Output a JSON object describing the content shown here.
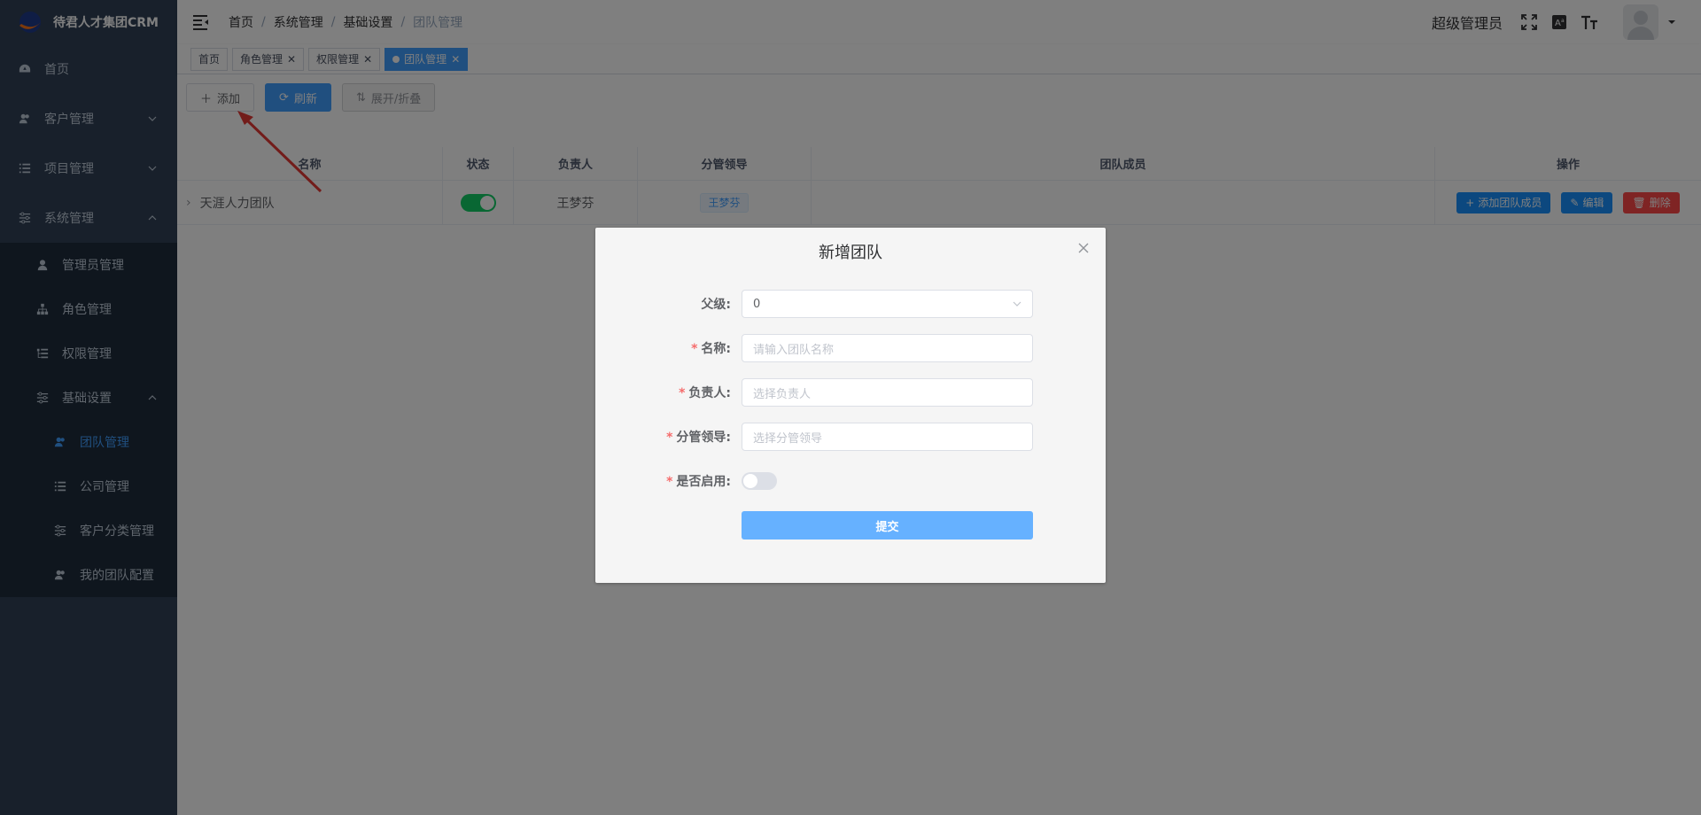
{
  "app": {
    "brand": "待君人才集团CRM"
  },
  "sidebar": {
    "items": [
      {
        "label": "首页",
        "icon": "dashboard-icon"
      },
      {
        "label": "客户管理",
        "icon": "users-icon"
      },
      {
        "label": "项目管理",
        "icon": "list-icon"
      },
      {
        "label": "系统管理",
        "icon": "sliders-icon"
      }
    ],
    "system_sub": [
      {
        "label": "管理员管理",
        "icon": "user-icon"
      },
      {
        "label": "角色管理",
        "icon": "tree-icon"
      },
      {
        "label": "权限管理",
        "icon": "list-tree-icon"
      },
      {
        "label": "基础设置",
        "icon": "sliders-icon"
      }
    ],
    "basic_sub": [
      {
        "label": "团队管理",
        "icon": "users-icon"
      },
      {
        "label": "公司管理",
        "icon": "list-icon"
      },
      {
        "label": "客户分类管理",
        "icon": "sliders-icon"
      },
      {
        "label": "我的团队配置",
        "icon": "users-icon"
      }
    ]
  },
  "header": {
    "breadcrumb": [
      "首页",
      "系统管理",
      "基础设置",
      "团队管理"
    ],
    "username": "超级管理员"
  },
  "tags": [
    {
      "label": "首页",
      "closable": false
    },
    {
      "label": "角色管理",
      "closable": true
    },
    {
      "label": "权限管理",
      "closable": true
    },
    {
      "label": "团队管理",
      "closable": true,
      "active": true
    }
  ],
  "toolbar": {
    "add": "添加",
    "refresh": "刷新",
    "expand": "展开/折叠"
  },
  "table": {
    "headers": [
      "名称",
      "状态",
      "负责人",
      "分管领导",
      "团队成员",
      "操作"
    ],
    "rows": [
      {
        "name": "天涯人力团队",
        "status": true,
        "leader": "王梦芬",
        "manager": "王梦芬",
        "members": ""
      }
    ],
    "actions": {
      "add_member": "添加团队成员",
      "edit": "编辑",
      "delete": "删除"
    }
  },
  "dialog": {
    "title": "新增团队",
    "fields": {
      "parent": {
        "label": "父级:",
        "value": "0"
      },
      "name": {
        "label": "名称:",
        "placeholder": "请输入团队名称"
      },
      "leader": {
        "label": "负责人:",
        "placeholder": "选择负责人"
      },
      "manager": {
        "label": "分管领导:",
        "placeholder": "选择分管领导"
      },
      "enabled": {
        "label": "是否启用:",
        "value": false
      }
    },
    "submit": "提交"
  },
  "colors": {
    "primary": "#409eff",
    "sidebar": "#304156",
    "success": "#13ce66",
    "danger": "#ff4949"
  }
}
